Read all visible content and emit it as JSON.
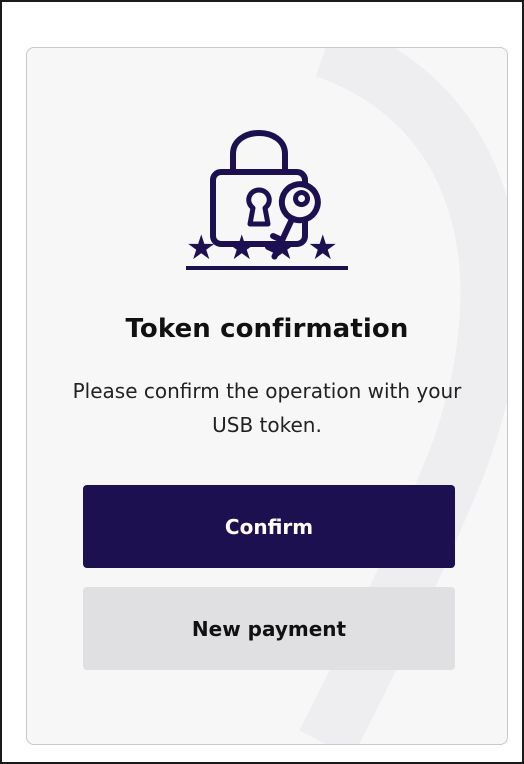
{
  "dialog": {
    "icon": "lock-with-key-icon",
    "masked_token": "★★★★",
    "title": "Token confirmation",
    "message": "Please confirm the operation with your USB token.",
    "confirm_label": "Confirm",
    "new_payment_label": "New payment"
  },
  "colors": {
    "primary": "#1d1050",
    "icon": "#1d1050",
    "secondary_button": "#e0e0e2",
    "card_background": "#f7f7f8"
  }
}
